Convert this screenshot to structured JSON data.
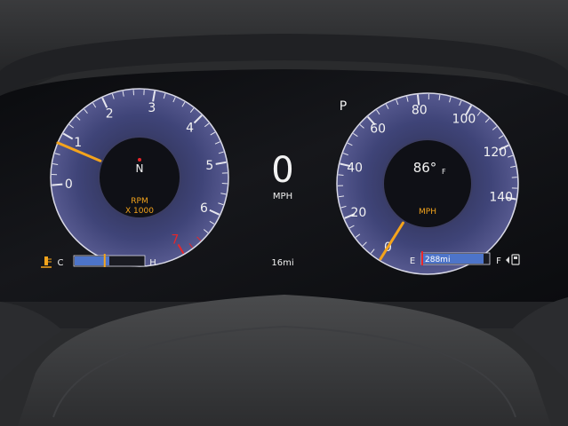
{
  "gear_indicator": "P",
  "tachometer": {
    "labels": [
      "0",
      "1",
      "2",
      "3",
      "4",
      "5",
      "6",
      "7"
    ],
    "unit_line1": "RPM",
    "unit_line2": "X 1000",
    "center_indicator": "N",
    "needle_value": 0.8,
    "max": 7,
    "redline_start": 6.5
  },
  "speed_center": {
    "value": "0",
    "unit": "MPH",
    "trip_readout": "16mi"
  },
  "speedometer": {
    "labels": [
      "0",
      "20",
      "40",
      "60",
      "80",
      "100",
      "120",
      "140"
    ],
    "unit": "MPH",
    "outside_temp_value": "86°",
    "outside_temp_unit": "F",
    "needle_value": 0,
    "max": 140
  },
  "temp_gauge": {
    "low_label": "C",
    "high_label": "H",
    "level": 0.5,
    "icon": "coolant-temperature-icon"
  },
  "fuel_gauge": {
    "empty_label": "E",
    "full_label": "F",
    "range_readout": "288mi",
    "level": 0.92,
    "icon": "fuel-pump-icon"
  },
  "colors": {
    "accent_amber": "#f4a41c",
    "redline": "#e8262b",
    "gauge_face": "#4a4f86",
    "bar_blue": "#4d74c9",
    "screen_bg": "#0c0d10"
  }
}
